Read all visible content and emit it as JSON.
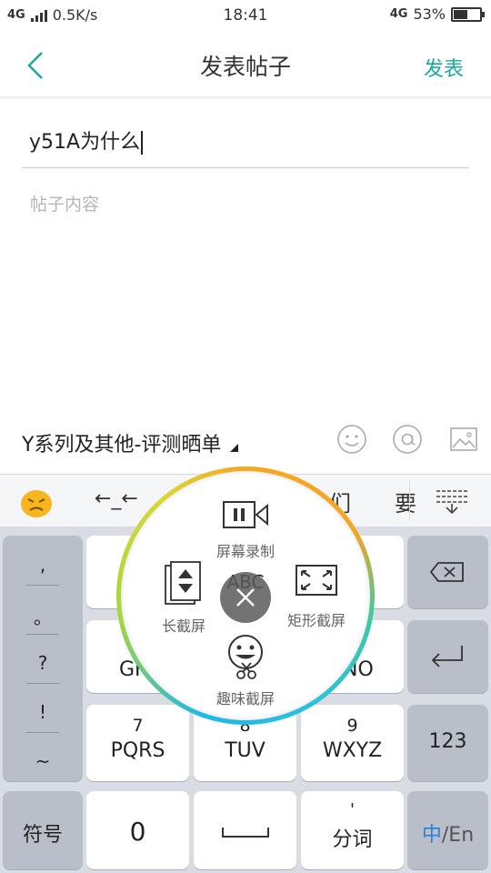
{
  "status_bar": {
    "network": "4G",
    "speed": "0.5K/s",
    "time": "18:41",
    "network_right": "4G",
    "battery_percent": "53%",
    "battery_level": 0.53
  },
  "header": {
    "title": "发表帖子",
    "publish_label": "发表"
  },
  "form": {
    "title_value": "y51A为什么",
    "content_placeholder": "帖子内容"
  },
  "category": {
    "label": "Y系列及其他-评测晒单"
  },
  "keyboard": {
    "candidates": [
      "←_←",
      "们",
      "要"
    ],
    "side_keys": [
      ",",
      "。",
      "?",
      "!",
      "~"
    ],
    "letter_keys_row2_left": "GH",
    "letter_keys_row2_right": "NO",
    "row3": [
      {
        "num": "7",
        "letters": "PQRS"
      },
      {
        "num": "8",
        "letters": "TUV"
      },
      {
        "num": "9",
        "letters": "WXYZ"
      }
    ],
    "num_key": "123",
    "symbol_key": "符号",
    "zero_key": "0",
    "split_key_top": "'",
    "split_key": "分词",
    "lang_key_active": "中",
    "lang_key_rest": "/En"
  },
  "overlay": {
    "record_label": "屏幕录制",
    "long_label": "长截屏",
    "rect_label": "矩形截屏",
    "fun_label": "趣味截屏",
    "abc_label": "ABC"
  },
  "colors": {
    "accent": "#1aa8a0",
    "lang_blue": "#2e7fd9",
    "ring_orange": "#f5a623",
    "ring_blue": "#1fb8e6",
    "ring_green": "#a6d63a"
  }
}
